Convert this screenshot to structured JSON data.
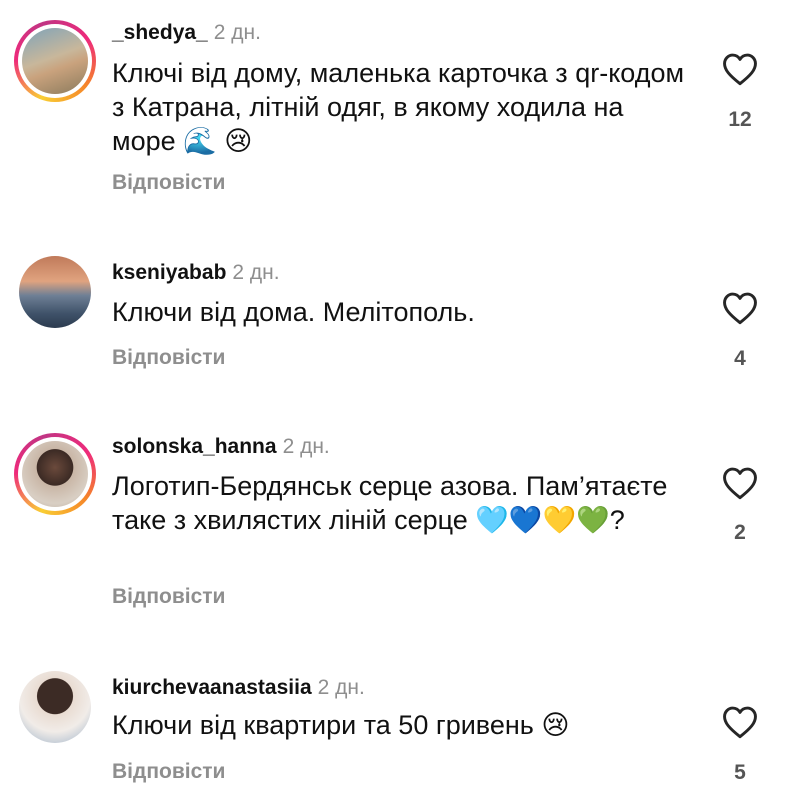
{
  "comments": [
    {
      "username": "_shedya_",
      "time": "2 дн.",
      "text": "Ключі від дому, маленька карточка з qr-кодом з Катрана, літній одяг, в якому ходила на море 🌊 😢",
      "reply_label": "Відповісти",
      "likes": "12",
      "story_ring": true
    },
    {
      "username": "kseniyabab",
      "time": "2 дн.",
      "text": "Ключи від дома. Мелітополь.",
      "reply_label": "Відповісти",
      "likes": "4",
      "story_ring": false
    },
    {
      "username": "solonska_hanna",
      "time": "2 дн.",
      "text": "Логотип-Бердянськ серце азова. Пам’ятаєте таке з хвилястих ліній серце 🩵💙💛💚?",
      "reply_label": "Відповісти",
      "likes": "2",
      "story_ring": true
    },
    {
      "username": "kiurchevaanastasiia",
      "time": "2 дн.",
      "text": "Ключи від квартири та 50 гривень 😢",
      "reply_label": "Відповісти",
      "likes": "5",
      "story_ring": false
    }
  ],
  "icons": {
    "like": "heart-outline-icon"
  }
}
